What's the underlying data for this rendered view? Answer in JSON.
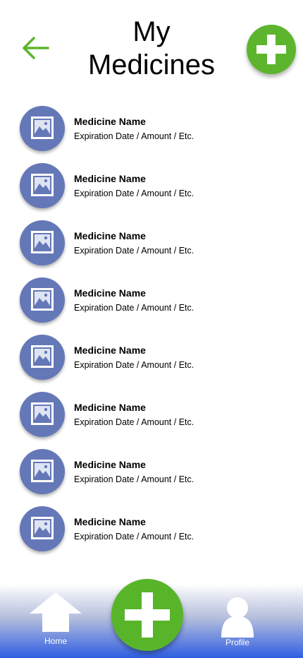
{
  "header": {
    "title": "My Medicines",
    "back_icon": "arrow-left-icon",
    "add_icon": "plus-icon"
  },
  "medicines": [
    {
      "name": "Medicine Name",
      "detail": "Expiration Date / Amount / Etc."
    },
    {
      "name": "Medicine Name",
      "detail": "Expiration Date / Amount / Etc."
    },
    {
      "name": "Medicine Name",
      "detail": "Expiration Date / Amount / Etc."
    },
    {
      "name": "Medicine Name",
      "detail": "Expiration Date / Amount / Etc."
    },
    {
      "name": "Medicine Name",
      "detail": "Expiration Date / Amount / Etc."
    },
    {
      "name": "Medicine Name",
      "detail": "Expiration Date / Amount / Etc."
    },
    {
      "name": "Medicine Name",
      "detail": "Expiration Date / Amount / Etc."
    },
    {
      "name": "Medicine Name",
      "detail": "Expiration Date / Amount / Etc."
    }
  ],
  "bottom_nav": {
    "home_label": "Home",
    "profile_label": "Profile",
    "home_icon": "home-icon",
    "add_icon": "plus-icon",
    "profile_icon": "person-icon"
  },
  "colors": {
    "accent_green": "#5cb52c",
    "avatar_blue": "#6478b8",
    "nav_gradient_end": "#2f5ee2"
  }
}
